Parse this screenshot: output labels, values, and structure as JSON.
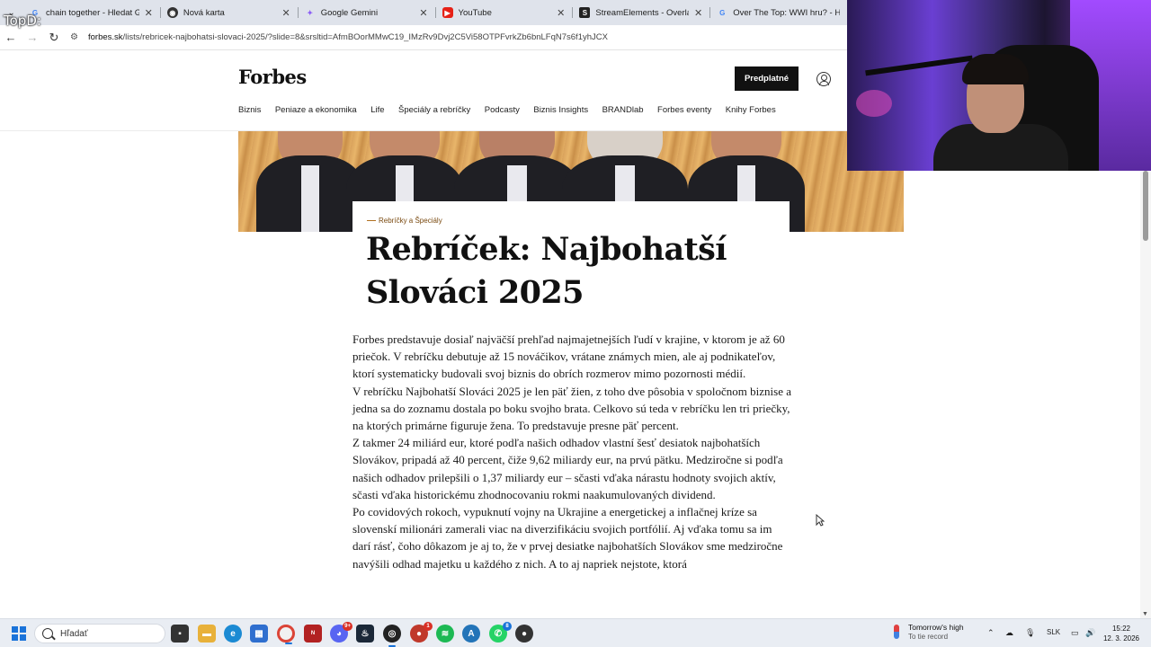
{
  "browser": {
    "tabs": [
      {
        "title": "chain together - Hledat Google",
        "favicon": "google-icon",
        "active": false
      },
      {
        "title": "Nová karta",
        "favicon": "chrome-icon",
        "active": false
      },
      {
        "title": "Google Gemini",
        "favicon": "gemini-icon",
        "active": false
      },
      {
        "title": "YouTube",
        "favicon": "youtube-icon",
        "active": false
      },
      {
        "title": "StreamElements - Overlays",
        "favicon": "streamelements-icon",
        "active": false
      },
      {
        "title": "Over The Top: WWI hru? - Hle",
        "favicon": "google-icon",
        "active": false
      }
    ],
    "url_host": "forbes.sk",
    "url_path": "/lists/rebricek-najbohatsi-slovaci-2025/?slide=8&srsltid=AfmBOorMMwC19_IMzRv9Dvj2C5Vi58OTPFvrkZb6bnLFqN7s6f1yhJCX",
    "overlay_text": "TopD:"
  },
  "forbes": {
    "logo": "Forbes",
    "subscribe_label": "Predplatné",
    "nav": [
      "Biznis",
      "Peniaze a ekonomika",
      "Life",
      "Špeciály a rebríčky",
      "Podcasty",
      "Biznis Insights",
      "BRANDlab",
      "Forbes eventy",
      "Knihy Forbes"
    ]
  },
  "article": {
    "kicker": "Rebríčky a Špeciály",
    "title": "Rebríček: Najbohatší Slováci 2025",
    "paragraphs": [
      "Forbes predstavuje dosiaľ najväčší prehľad najmajetnejších ľudí v krajine, v ktorom je až 60 priečok. V rebríčku debutuje až 15 nováčikov, vrátane známych mien, ale aj podnikateľov, ktorí systematicky budovali svoj biznis do obrích rozmerov mimo pozornosti médií.",
      "V rebríčku Najbohatší Slováci 2025  je len päť žien, z toho dve pôsobia v spoločnom biznise a jedna sa do zoznamu dostala po boku svojho brata. Celkovo sú teda v rebríčku len tri priečky, na ktorých primárne figuruje žena. To predstavuje presne päť percent.",
      "Z takmer 24 miliárd eur, ktoré podľa našich odhadov vlastní šesť desiatok najbohatších Slovákov, pripadá až 40 percent, čiže 9,62 miliardy eur, na prvú pätku. Medziročne si podľa našich odhadov prilepšili o 1,37 miliardy eur – sčasti vďaka nárastu hodnoty svojich aktív, sčasti vďaka historickému zhodnocovaniu rokmi naakumulovaných dividend.",
      "Po covidových rokoch, vypuknutí vojny na Ukrajine a energetickej a inflačnej kríze sa slovenskí milionári zamerali viac na diverzifikáciu svojich portfólií. Aj vďaka tomu sa im darí rásť, čoho dôkazom je aj to, že v prvej desiatke najbohatších Slovákov sme medziročne navýšili odhad majetku u každého z nich. A to aj napriek nejstote, ktorá"
    ]
  },
  "taskbar": {
    "search_placeholder": "Hľadať",
    "weather_title": "Tomorrow's high",
    "weather_sub": "To tie record",
    "lang": "SLK",
    "time": "15:22",
    "date": "12. 3. 2026",
    "badges": {
      "discord": "9+",
      "app1": "1",
      "app2": "8"
    }
  }
}
